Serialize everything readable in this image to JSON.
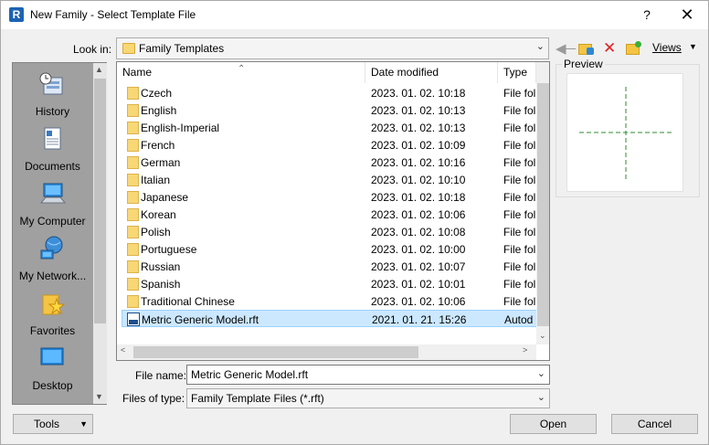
{
  "title_bar": {
    "title": "New Family - Select Template File",
    "help_label": "?",
    "close_label": "✕",
    "app_icon_letter": "R"
  },
  "lookin": {
    "label": "Look in:",
    "value": "Family Templates"
  },
  "toolbar": {
    "views_label": "Views",
    "icons": [
      "back-arrow-icon",
      "up-folder-icon",
      "delete-icon",
      "new-folder-icon"
    ]
  },
  "places": [
    {
      "label": "History",
      "icon": "history-icon"
    },
    {
      "label": "Documents",
      "icon": "documents-icon"
    },
    {
      "label": "My Computer",
      "icon": "computer-icon"
    },
    {
      "label": "My Network...",
      "icon": "network-icon"
    },
    {
      "label": "Favorites",
      "icon": "favorites-icon"
    },
    {
      "label": "Desktop",
      "icon": "desktop-icon"
    }
  ],
  "columns": {
    "name": "Name",
    "date": "Date modified",
    "type": "Type"
  },
  "files": [
    {
      "name": "Czech",
      "date": "2023. 01. 02. 10:18",
      "type": "File fol"
    },
    {
      "name": "English",
      "date": "2023. 01. 02. 10:13",
      "type": "File fol"
    },
    {
      "name": "English-Imperial",
      "date": "2023. 01. 02. 10:13",
      "type": "File fol"
    },
    {
      "name": "French",
      "date": "2023. 01. 02. 10:09",
      "type": "File fol"
    },
    {
      "name": "German",
      "date": "2023. 01. 02. 10:16",
      "type": "File fol"
    },
    {
      "name": "Italian",
      "date": "2023. 01. 02. 10:10",
      "type": "File fol"
    },
    {
      "name": "Japanese",
      "date": "2023. 01. 02. 10:18",
      "type": "File fol"
    },
    {
      "name": "Korean",
      "date": "2023. 01. 02. 10:06",
      "type": "File fol"
    },
    {
      "name": "Polish",
      "date": "2023. 01. 02. 10:08",
      "type": "File fol"
    },
    {
      "name": "Portuguese",
      "date": "2023. 01. 02. 10:00",
      "type": "File fol"
    },
    {
      "name": "Russian",
      "date": "2023. 01. 02. 10:07",
      "type": "File fol"
    },
    {
      "name": "Spanish",
      "date": "2023. 01. 02. 10:01",
      "type": "File fol"
    },
    {
      "name": "Traditional Chinese",
      "date": "2023. 01. 02. 10:06",
      "type": "File fol"
    },
    {
      "name": "Metric Generic Model.rft",
      "date": "2021. 01. 21. 15:26",
      "type": "Autod"
    }
  ],
  "preview": {
    "label": "Preview"
  },
  "filename": {
    "label": "File name:",
    "value": "Metric Generic Model.rft"
  },
  "filetype": {
    "label": "Files of type:",
    "value": "Family Template Files  (*.rft)"
  },
  "buttons": {
    "tools": "Tools",
    "open": "Open",
    "cancel": "Cancel"
  },
  "colors": {
    "selection": "#cce8ff",
    "folder": "#f8d775",
    "places_bg": "#a0a0a0",
    "preview_line": "#2e8b2e"
  }
}
